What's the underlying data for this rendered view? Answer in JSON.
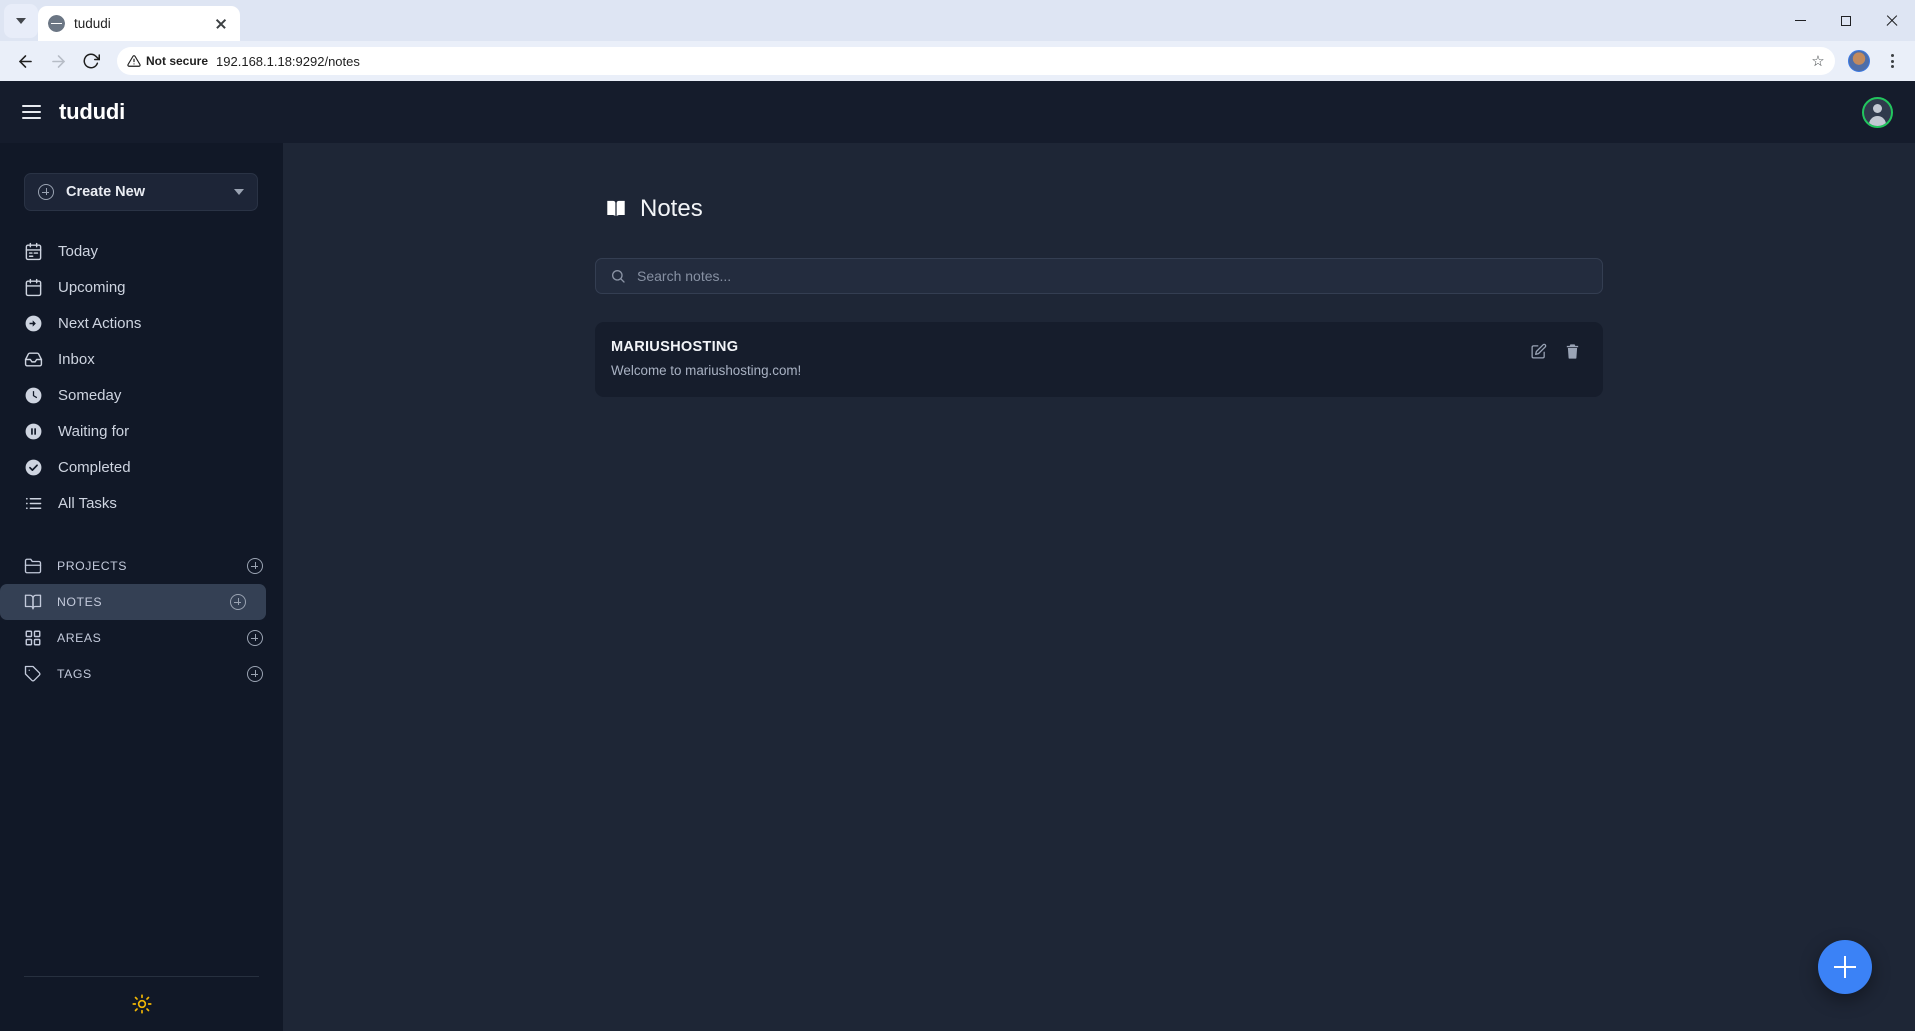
{
  "browser": {
    "tab_title": "tududi",
    "security_label": "Not secure",
    "url": "192.168.1.18:9292/notes",
    "tab_list_icon": "chevron-down-icon",
    "back_icon": "back-arrow-icon",
    "forward_icon": "forward-arrow-icon",
    "reload_icon": "reload-icon",
    "bookmark_icon": "star-icon",
    "menu_icon": "kebab-menu-icon",
    "minimize_icon": "minimize-icon",
    "maximize_icon": "maximize-icon",
    "close_icon": "close-icon"
  },
  "appbar": {
    "menu_icon": "hamburger-menu-icon",
    "brand": "tududi",
    "avatar_icon": "user-avatar-icon",
    "avatar_ring_color": "#22c55e"
  },
  "sidebar": {
    "create_new": {
      "label": "Create New",
      "plus_icon": "circle-plus-icon",
      "chevron_icon": "chevron-down-icon"
    },
    "nav_items": [
      {
        "label": "Today",
        "icon": "calendar-today-icon"
      },
      {
        "label": "Upcoming",
        "icon": "calendar-icon"
      },
      {
        "label": "Next Actions",
        "icon": "arrow-right-circle-icon"
      },
      {
        "label": "Inbox",
        "icon": "inbox-icon"
      },
      {
        "label": "Someday",
        "icon": "clock-icon"
      },
      {
        "label": "Waiting for",
        "icon": "pause-circle-icon"
      },
      {
        "label": "Completed",
        "icon": "check-circle-icon"
      },
      {
        "label": "All Tasks",
        "icon": "list-icon"
      }
    ],
    "categories": [
      {
        "label": "PROJECTS",
        "icon": "folder-icon",
        "add_icon": "circle-plus-icon",
        "active": false
      },
      {
        "label": "NOTES",
        "icon": "book-icon",
        "add_icon": "circle-plus-icon",
        "active": true
      },
      {
        "label": "AREAS",
        "icon": "grid-icon",
        "add_icon": "circle-plus-icon",
        "active": false
      },
      {
        "label": "TAGS",
        "icon": "tag-icon",
        "add_icon": "circle-plus-icon",
        "active": false
      }
    ],
    "theme_toggle_icon": "sun-icon",
    "theme_toggle_color": "#f2b705"
  },
  "main": {
    "page_title": "Notes",
    "page_title_icon": "book-icon",
    "search": {
      "placeholder": "Search notes...",
      "value": "",
      "icon": "search-icon"
    },
    "notes": [
      {
        "title": "MARIUSHOSTING",
        "body": "Welcome to mariushosting.com!",
        "edit_icon": "edit-pencil-icon",
        "delete_icon": "trash-icon"
      }
    ],
    "fab": {
      "icon": "plus-icon",
      "color": "#3b82f6"
    }
  }
}
